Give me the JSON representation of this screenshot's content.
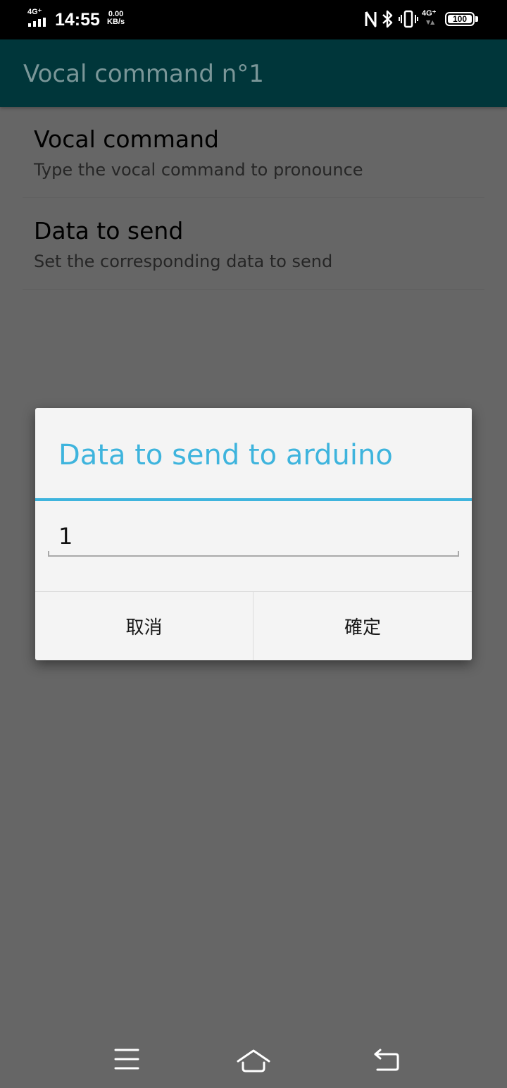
{
  "status_bar": {
    "network_left": "4G⁺",
    "time": "14:55",
    "speed_value": "0.00",
    "speed_unit": "KB/s",
    "network_right": "4G⁺",
    "battery": "100"
  },
  "app_bar": {
    "title": "Vocal command n°1"
  },
  "preferences": [
    {
      "title": "Vocal command",
      "summary": "Type the vocal command to pronounce"
    },
    {
      "title": "Data to send",
      "summary": "Set the corresponding data to send"
    }
  ],
  "dialog": {
    "title": "Data to send to arduino",
    "input_value": "1",
    "cancel_label": "取消",
    "ok_label": "確定"
  },
  "colors": {
    "app_bar": "#00363a",
    "accent": "#3eb4dd",
    "scrim": "#666666"
  },
  "icons": {
    "nfc": "nfc-icon",
    "bluetooth": "bluetooth-icon",
    "vibrate": "vibrate-icon",
    "battery": "battery-icon",
    "menu": "menu-icon",
    "home": "home-icon",
    "back": "back-icon"
  }
}
